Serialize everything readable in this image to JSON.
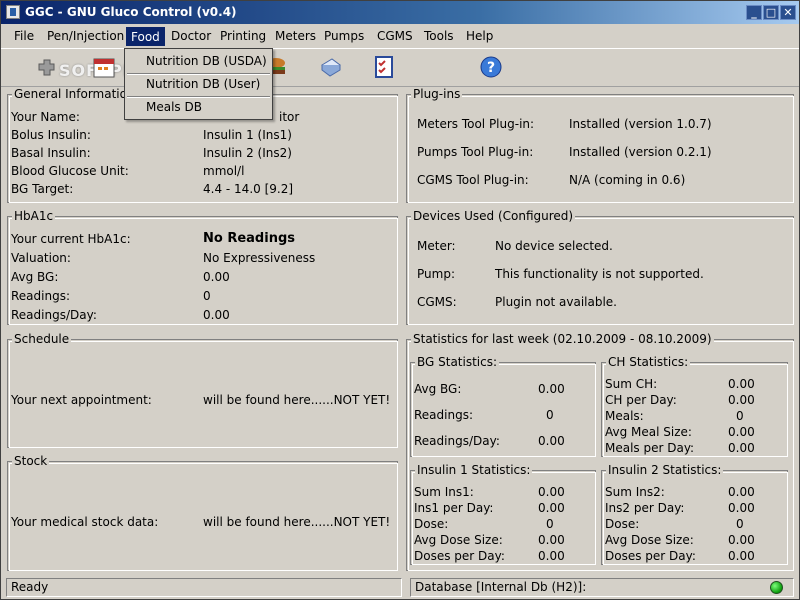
{
  "window": {
    "title": "GGC - GNU Gluco Control (v0.4)",
    "minimize": "_",
    "maximize": "□",
    "close": "✕"
  },
  "menu": [
    "File",
    "Pen/Injection",
    "Food",
    "Doctor",
    "Printing",
    "Meters",
    "Pumps",
    "CGMS",
    "Tools",
    "Help"
  ],
  "food_menu": {
    "items": [
      "Nutrition DB (USDA)",
      "Nutrition DB (User)",
      "Meals DB"
    ]
  },
  "toolbar": {
    "watermark": "SOFTPEDIA",
    "icons": [
      "plugin-icon",
      "calendar-icon",
      "food-icon",
      "print-icon",
      "checklist-icon",
      "help-icon"
    ]
  },
  "general": {
    "title": "General Information",
    "rows": [
      {
        "label": "Your Name:",
        "value": "itor"
      },
      {
        "label": "Bolus Insulin:",
        "value": "Insulin 1  (Ins1)"
      },
      {
        "label": "Basal Insulin:",
        "value": "Insulin 2  (Ins2)"
      },
      {
        "label": "Blood Glucose Unit:",
        "value": "mmol/l"
      },
      {
        "label": "BG Target:",
        "value": "4.4 - 14.0 [9.2]"
      }
    ]
  },
  "plugins": {
    "title": "Plug-ins",
    "rows": [
      {
        "label": "Meters Tool Plug-in:",
        "value": "Installed (version 1.0.7)"
      },
      {
        "label": "Pumps Tool Plug-in:",
        "value": "Installed (version 0.2.1)"
      },
      {
        "label": "CGMS Tool Plug-in:",
        "value": "N/A (coming in 0.6)"
      }
    ]
  },
  "hba1c": {
    "title": "HbA1c",
    "rows": [
      {
        "label": "Your current HbA1c:",
        "value": "No Readings"
      },
      {
        "label": "Valuation:",
        "value": "No Expressiveness"
      },
      {
        "label": "Avg BG:",
        "value": "0.00"
      },
      {
        "label": "Readings:",
        "value": "0"
      },
      {
        "label": "Readings/Day:",
        "value": "0.00"
      }
    ]
  },
  "devices": {
    "title": "Devices Used (Configured)",
    "rows": [
      {
        "label": "Meter:",
        "value": "No device selected."
      },
      {
        "label": "Pump:",
        "value": "This functionality is not supported."
      },
      {
        "label": "CGMS:",
        "value": "Plugin not available."
      }
    ]
  },
  "schedule": {
    "title": "Schedule",
    "label": "Your next appointment:",
    "value": "will be found here......NOT YET!"
  },
  "stock": {
    "title": "Stock",
    "label": "Your medical stock data:",
    "value": "will be found here......NOT YET!"
  },
  "statistics": {
    "title": "Statistics for last week (02.10.2009 - 08.10.2009)",
    "bg": {
      "title": "BG Statistics:",
      "rows": [
        {
          "label": "Avg BG:",
          "value": "0.00"
        },
        {
          "label": "Readings:",
          "value": "0"
        },
        {
          "label": "Readings/Day:",
          "value": "0.00"
        }
      ]
    },
    "ch": {
      "title": "CH Statistics:",
      "rows": [
        {
          "label": "Sum CH:",
          "value": "0.00"
        },
        {
          "label": "CH per Day:",
          "value": "0.00"
        },
        {
          "label": "Meals:",
          "value": "0"
        },
        {
          "label": "Avg Meal Size:",
          "value": "0.00"
        },
        {
          "label": "Meals per Day:",
          "value": "0.00"
        }
      ]
    },
    "ins1": {
      "title": "Insulin 1 Statistics:",
      "rows": [
        {
          "label": "Sum Ins1:",
          "value": "0.00"
        },
        {
          "label": "Ins1 per Day:",
          "value": "0.00"
        },
        {
          "label": "Dose:",
          "value": "0"
        },
        {
          "label": "Avg Dose Size:",
          "value": "0.00"
        },
        {
          "label": "Doses per Day:",
          "value": "0.00"
        }
      ]
    },
    "ins2": {
      "title": "Insulin 2 Statistics:",
      "rows": [
        {
          "label": "Sum Ins2:",
          "value": "0.00"
        },
        {
          "label": "Ins2 per Day:",
          "value": "0.00"
        },
        {
          "label": "Dose:",
          "value": "0"
        },
        {
          "label": "Avg Dose Size:",
          "value": "0.00"
        },
        {
          "label": "Doses per Day:",
          "value": "0.00"
        }
      ]
    }
  },
  "status": {
    "left": "Ready",
    "right": "Database [Internal Db (H2)]:",
    "led_color": "#1aa51a"
  }
}
